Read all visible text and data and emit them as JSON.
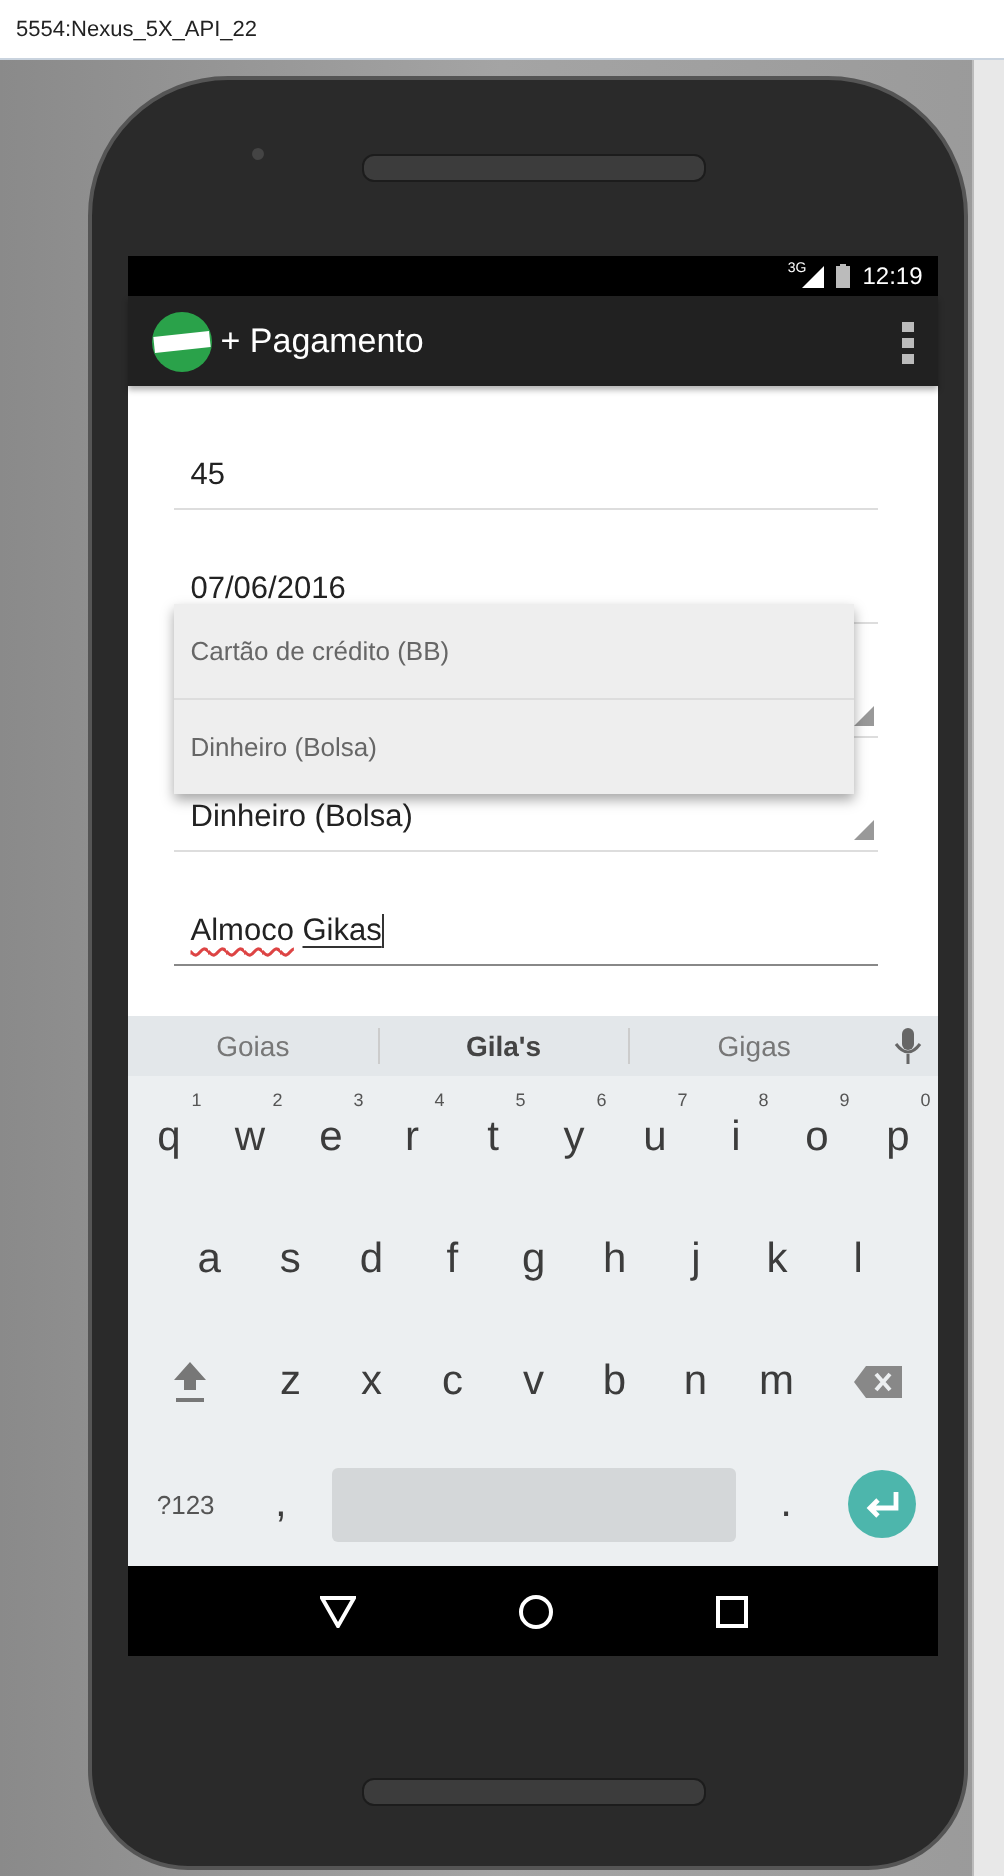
{
  "window": {
    "title": "5554:Nexus_5X_API_22"
  },
  "status_bar": {
    "network": "3G",
    "time": "12:19"
  },
  "app_bar": {
    "title": "+ Pagamento"
  },
  "form": {
    "fields": [
      {
        "kind": "text",
        "value": "45",
        "focused": false
      },
      {
        "kind": "text",
        "value": "07/06/2016",
        "focused": false
      },
      {
        "kind": "spinner",
        "expanded": true,
        "options": [
          {
            "label": "Cartão de crédito (BB)"
          },
          {
            "label": "Dinheiro (Bolsa)"
          }
        ]
      },
      {
        "kind": "spinner",
        "value": "Dinheiro (Bolsa)",
        "expanded": false
      },
      {
        "kind": "text",
        "value": "Almoco Gikas",
        "focused": true
      }
    ]
  },
  "keyboard": {
    "suggestions": [
      {
        "label": "Goias",
        "selected": false
      },
      {
        "label": "Gila's",
        "selected": true
      },
      {
        "label": "Gigas",
        "selected": false
      }
    ],
    "rows": [
      [
        {
          "kind": "letter",
          "label": "q",
          "hint": "1"
        },
        {
          "kind": "letter",
          "label": "w",
          "hint": "2"
        },
        {
          "kind": "letter",
          "label": "e",
          "hint": "3"
        },
        {
          "kind": "letter",
          "label": "r",
          "hint": "4"
        },
        {
          "kind": "letter",
          "label": "t",
          "hint": "5"
        },
        {
          "kind": "letter",
          "label": "y",
          "hint": "6"
        },
        {
          "kind": "letter",
          "label": "u",
          "hint": "7"
        },
        {
          "kind": "letter",
          "label": "i",
          "hint": "8"
        },
        {
          "kind": "letter",
          "label": "o",
          "hint": "9"
        },
        {
          "kind": "letter",
          "label": "p",
          "hint": "0"
        }
      ],
      [
        {
          "kind": "letter",
          "label": "a"
        },
        {
          "kind": "letter",
          "label": "s"
        },
        {
          "kind": "letter",
          "label": "d"
        },
        {
          "kind": "letter",
          "label": "f"
        },
        {
          "kind": "letter",
          "label": "g"
        },
        {
          "kind": "letter",
          "label": "h"
        },
        {
          "kind": "letter",
          "label": "j"
        },
        {
          "kind": "letter",
          "label": "k"
        },
        {
          "kind": "letter",
          "label": "l"
        }
      ],
      [
        {
          "kind": "shift"
        },
        {
          "kind": "letter",
          "label": "z"
        },
        {
          "kind": "letter",
          "label": "x"
        },
        {
          "kind": "letter",
          "label": "c"
        },
        {
          "kind": "letter",
          "label": "v"
        },
        {
          "kind": "letter",
          "label": "b"
        },
        {
          "kind": "letter",
          "label": "n"
        },
        {
          "kind": "letter",
          "label": "m"
        },
        {
          "kind": "backspace"
        }
      ]
    ],
    "bottom_row": [
      {
        "kind": "symbols",
        "label": "?123"
      },
      {
        "kind": "letter",
        "label": ","
      },
      {
        "kind": "space"
      },
      {
        "kind": "letter",
        "label": "."
      },
      {
        "kind": "enter"
      }
    ]
  }
}
